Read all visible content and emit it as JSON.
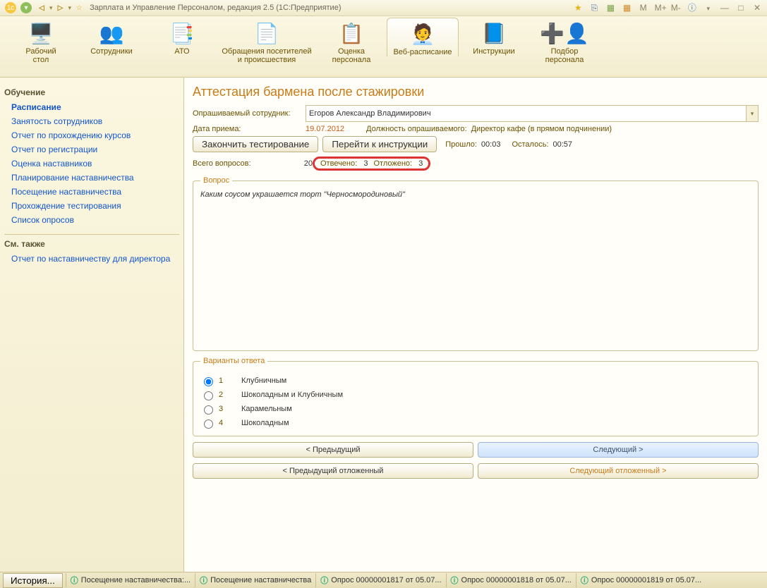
{
  "titlebar": {
    "app_title": "Зарплата и Управление Персоналом, редакция 2.5  (1С:Предприятие)"
  },
  "toolbar": {
    "items": [
      {
        "label": "Рабочий\nстол"
      },
      {
        "label": "Сотрудники"
      },
      {
        "label": "АТО"
      },
      {
        "label": "Обращения посетителей\nи происшествия"
      },
      {
        "label": "Оценка\nперсонала"
      },
      {
        "label": "Веб-расписание"
      },
      {
        "label": "Инструкции"
      },
      {
        "label": "Подбор\nперсонала"
      }
    ]
  },
  "sidebar": {
    "group1_title": "Обучение",
    "links1": [
      "Расписание",
      "Занятость сотрудников",
      "Отчет по прохождению курсов",
      "Отчет по регистрации",
      "Оценка наставников",
      "Планирование наставничества",
      "Посещение наставничества",
      "Прохождение тестирования",
      "Список опросов"
    ],
    "group2_title": "См. также",
    "links2": [
      "Отчет по наставничеству для директора"
    ]
  },
  "page": {
    "title": "Аттестация бармена после стажировки",
    "emp_label": "Опрашиваемый сотрудник:",
    "emp_value": "Егоров Александр Владимирович",
    "date_label": "Дата приема:",
    "date_value": "19.07.2012",
    "pos_label": "Должность опрашиваемого:",
    "pos_value": "Директор кафе (в прямом подчинении)",
    "finish_btn": "Закончить тестирование",
    "goto_btn": "Перейти к инструкции",
    "elapsed_label": "Прошло:",
    "elapsed_value": "00:03",
    "remain_label": "Осталось:",
    "remain_value": "00:57",
    "total_label": "Всего вопросов:",
    "total_value": "20",
    "answered_label": "Отвечено:",
    "answered_value": "3",
    "postponed_label": "Отложено:",
    "postponed_value": "3",
    "question_legend": "Вопрос",
    "question_text": "Каким соусом украшается торт \"Черносмородиновый\"",
    "answers_legend": "Варианты ответа",
    "answers": [
      {
        "n": "1",
        "t": "Клубничным"
      },
      {
        "n": "2",
        "t": "Шоколадным и Клубничным"
      },
      {
        "n": "3",
        "t": "Карамельным"
      },
      {
        "n": "4",
        "t": "Шоколадным"
      }
    ],
    "prev_btn": "< Предыдущий",
    "next_btn": "Следующий >",
    "prev_post_btn": "< Предыдущий отложенный",
    "next_post_btn": "Следующий отложенный >"
  },
  "bottombar": {
    "history": "История...",
    "tabs": [
      "Посещение наставничества:...",
      "Посещение наставничества",
      "Опрос 00000001817 от 05.07...",
      "Опрос 00000001818 от 05.07...",
      "Опрос 00000001819 от 05.07..."
    ]
  }
}
